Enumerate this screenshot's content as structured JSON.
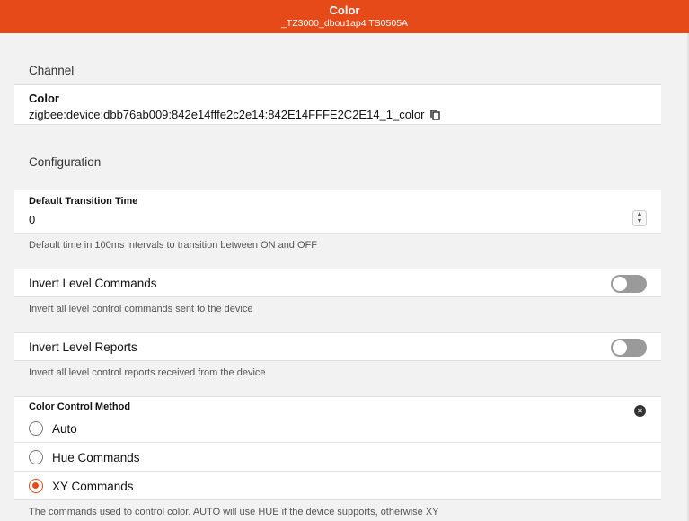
{
  "header": {
    "title": "Color",
    "subtitle": "_TZ3000_dbou1ap4 TS0505A"
  },
  "channel": {
    "section_title": "Channel",
    "name": "Color",
    "uid": "zigbee:device:dbb76ab009:842e14fffe2c2e14:842E14FFFE2C2E14_1_color",
    "copy_icon": "copy-icon"
  },
  "configuration": {
    "section_title": "Configuration",
    "transition": {
      "label": "Default Transition Time",
      "value": "0",
      "help": "Default time in 100ms intervals to transition between ON and OFF",
      "stepper_up": "▲",
      "stepper_down": "▼"
    },
    "invert_level_commands": {
      "label": "Invert Level Commands",
      "checked": false,
      "help": "Invert all level control commands sent to the device"
    },
    "invert_level_reports": {
      "label": "Invert Level Reports",
      "checked": false,
      "help": "Invert all level control reports received from the device"
    },
    "color_control_method": {
      "label": "Color Control Method",
      "clear_icon": "clear-circle-icon",
      "clear_glyph": "✕",
      "options": [
        {
          "label": "Auto",
          "checked": false
        },
        {
          "label": "Hue Commands",
          "checked": false
        },
        {
          "label": "XY Commands",
          "checked": true
        }
      ],
      "help": "The commands used to control color. AUTO will use HUE if the device supports, otherwise XY"
    }
  },
  "colors": {
    "accent": "#e64a19",
    "background": "#f2f2f2",
    "card": "#ffffff",
    "toggle_off": "#9a9a9a"
  }
}
